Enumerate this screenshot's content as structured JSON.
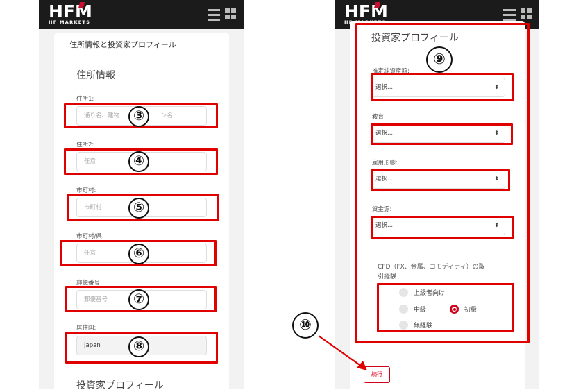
{
  "brand": {
    "name": "HFM",
    "tagline": "HF MARKETS"
  },
  "left_screen": {
    "card_header": "住所情報と投資家プロフィール",
    "section_title": "住所情報",
    "fields": [
      {
        "label": "住所1:",
        "placeholder": "通り名、建物",
        "placeholder_tail": "ン名",
        "badge": "③"
      },
      {
        "label": "住所2:",
        "placeholder": "任意",
        "badge": "④"
      },
      {
        "label": "市町村:",
        "placeholder": "市町村",
        "badge": "⑤"
      },
      {
        "label": "市町村/県:",
        "placeholder": "任意",
        "badge": "⑥"
      },
      {
        "label": "郵便番号:",
        "placeholder": "郵便番号",
        "badge": "⑦"
      },
      {
        "label": "居住国:",
        "value": "Japan",
        "badge": "⑧"
      }
    ],
    "next_section_title": "投資家プロフィール"
  },
  "right_screen": {
    "section_title": "投資家プロフィール",
    "group_badge": "⑨",
    "selects": [
      {
        "label": "推定純資産額:",
        "value": "選択..."
      },
      {
        "label": "教育:",
        "value": "選択..."
      },
      {
        "label": "雇用形態:",
        "value": "選択..."
      },
      {
        "label": "資金源:",
        "value": "選択..."
      }
    ],
    "experience": {
      "label_line1": "CFD（FX、金属、コモディティ）の取",
      "label_line2": "引経験",
      "options": [
        {
          "label": "上級者向け",
          "checked": false
        },
        {
          "label": "中級",
          "checked": false
        },
        {
          "label": "初級",
          "checked": true
        },
        {
          "label": "無経験",
          "checked": false
        }
      ]
    },
    "continue_label": "続行",
    "continue_badge": "⑩"
  },
  "colors": {
    "highlight": "#e10000",
    "brand_red": "#d0021b",
    "topbar": "#1b1b1b"
  }
}
